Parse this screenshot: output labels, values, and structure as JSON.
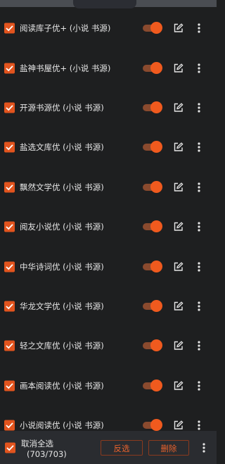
{
  "sources": [
    {
      "label": "阅读库子优+ (小说 书源)",
      "checked": true,
      "enabled": true
    },
    {
      "label": "盐神书屋优+ (小说 书源)",
      "checked": true,
      "enabled": true
    },
    {
      "label": "开源书源优 (小说 书源)",
      "checked": true,
      "enabled": true
    },
    {
      "label": "盐选文库优 (小说 书源)",
      "checked": true,
      "enabled": true
    },
    {
      "label": "飘然文学优 (小说 书源)",
      "checked": true,
      "enabled": true
    },
    {
      "label": "阅友小说优 (小说 书源)",
      "checked": true,
      "enabled": true
    },
    {
      "label": "中华诗词优 (小说 书源)",
      "checked": true,
      "enabled": true
    },
    {
      "label": "华龙文学优 (小说 书源)",
      "checked": true,
      "enabled": true
    },
    {
      "label": "轻之文库优 (小说 书源)",
      "checked": true,
      "enabled": true
    },
    {
      "label": "画本阅读优 (小说 书源)",
      "checked": true,
      "enabled": true
    },
    {
      "label": "小说阅读优 (小说 书源)",
      "checked": true,
      "enabled": true
    }
  ],
  "bottom_bar": {
    "select_all_label": "取消全选",
    "selected_count": "(703/703)",
    "invert_label": "反选",
    "delete_label": "删除"
  },
  "colors": {
    "accent": "#f05a1e",
    "background": "#1e1f20",
    "bottom_bar": "#2a2c30"
  }
}
